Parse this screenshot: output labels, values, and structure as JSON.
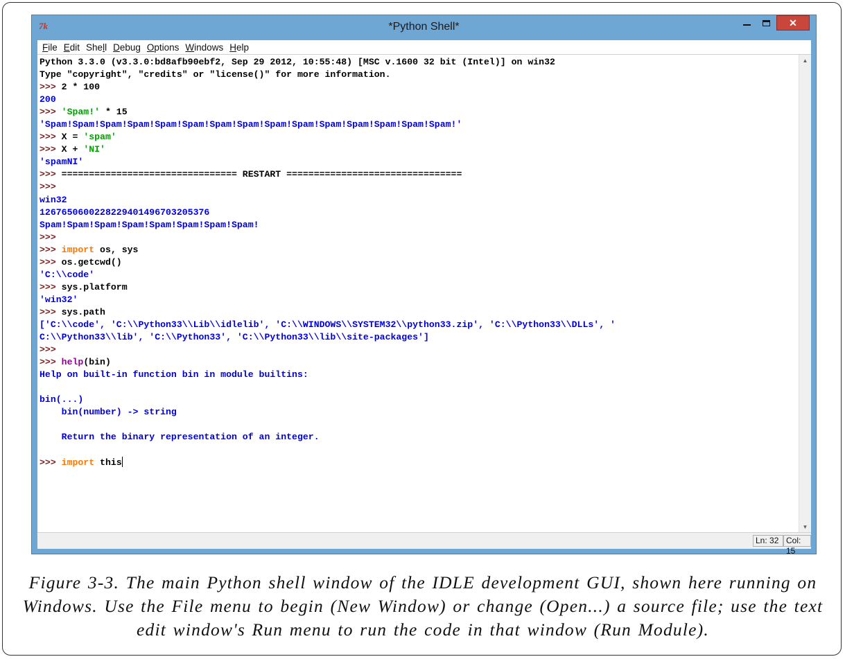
{
  "window": {
    "title": "*Python Shell*",
    "app_icon": "7k",
    "close_label": "✕"
  },
  "menu": [
    {
      "label": "File",
      "u": "F",
      "rest": "ile"
    },
    {
      "label": "Edit",
      "u": "E",
      "rest": "dit"
    },
    {
      "label": "Shell",
      "pre": "She",
      "u": "l",
      "rest": "l"
    },
    {
      "label": "Debug",
      "u": "D",
      "rest": "ebug"
    },
    {
      "label": "Options",
      "u": "O",
      "rest": "ptions"
    },
    {
      "label": "Windows",
      "u": "W",
      "rest": "indows"
    },
    {
      "label": "Help",
      "u": "H",
      "rest": "elp"
    }
  ],
  "shell_lines": [
    [
      [
        "black",
        "Python 3.3.0 (v3.3.0:bd8afb90ebf2, Sep 29 2012, 10:55:48) [MSC v.1600 32 bit (Intel)] on win32"
      ]
    ],
    [
      [
        "black",
        "Type \"copyright\", \"credits\" or \"license()\" for more information."
      ]
    ],
    [
      [
        "maroon",
        ">>> "
      ],
      [
        "black",
        "2 * 100"
      ]
    ],
    [
      [
        "blue",
        "200"
      ]
    ],
    [
      [
        "maroon",
        ">>> "
      ],
      [
        "green",
        "'Spam!'"
      ],
      [
        "black",
        " * 15"
      ]
    ],
    [
      [
        "blue",
        "'Spam!Spam!Spam!Spam!Spam!Spam!Spam!Spam!Spam!Spam!Spam!Spam!Spam!Spam!Spam!'"
      ]
    ],
    [
      [
        "maroon",
        ">>> "
      ],
      [
        "black",
        "X = "
      ],
      [
        "green",
        "'spam'"
      ]
    ],
    [
      [
        "maroon",
        ">>> "
      ],
      [
        "black",
        "X + "
      ],
      [
        "green",
        "'NI'"
      ]
    ],
    [
      [
        "blue",
        "'spamNI'"
      ]
    ],
    [
      [
        "maroon",
        ">>> "
      ],
      [
        "black",
        "================================ RESTART ================================"
      ]
    ],
    [
      [
        "maroon",
        ">>> "
      ]
    ],
    [
      [
        "blue",
        "win32"
      ]
    ],
    [
      [
        "blue",
        "1267650600228229401496703205376"
      ]
    ],
    [
      [
        "blue",
        "Spam!Spam!Spam!Spam!Spam!Spam!Spam!Spam!"
      ]
    ],
    [
      [
        "maroon",
        ">>> "
      ]
    ],
    [
      [
        "maroon",
        ">>> "
      ],
      [
        "orange",
        "import"
      ],
      [
        "black",
        " os, sys"
      ]
    ],
    [
      [
        "maroon",
        ">>> "
      ],
      [
        "black",
        "os.getcwd()"
      ]
    ],
    [
      [
        "blue",
        "'C:\\\\code'"
      ]
    ],
    [
      [
        "maroon",
        ">>> "
      ],
      [
        "black",
        "sys.platform"
      ]
    ],
    [
      [
        "blue",
        "'win32'"
      ]
    ],
    [
      [
        "maroon",
        ">>> "
      ],
      [
        "black",
        "sys.path"
      ]
    ],
    [
      [
        "blue",
        "['C:\\\\code', 'C:\\\\Python33\\\\Lib\\\\idlelib', 'C:\\\\WINDOWS\\\\SYSTEM32\\\\python33.zip', 'C:\\\\Python33\\\\DLLs', '"
      ]
    ],
    [
      [
        "blue",
        "C:\\\\Python33\\\\lib', 'C:\\\\Python33', 'C:\\\\Python33\\\\lib\\\\site-packages']"
      ]
    ],
    [
      [
        "maroon",
        ">>> "
      ]
    ],
    [
      [
        "maroon",
        ">>> "
      ],
      [
        "purple",
        "help"
      ],
      [
        "black",
        "(bin)"
      ]
    ],
    [
      [
        "blue",
        "Help on built-in function bin in module builtins:"
      ]
    ],
    [
      [
        "blue",
        ""
      ]
    ],
    [
      [
        "blue",
        "bin(...)"
      ]
    ],
    [
      [
        "blue",
        "    bin(number) -> string"
      ]
    ],
    [
      [
        "blue",
        ""
      ]
    ],
    [
      [
        "blue",
        "    Return the binary representation of an integer."
      ]
    ],
    [
      [
        "blue",
        ""
      ]
    ],
    [
      [
        "maroon",
        ">>> "
      ],
      [
        "orange",
        "import"
      ],
      [
        "black",
        " this"
      ]
    ]
  ],
  "status": {
    "line": "Ln: 32",
    "col": "Col: 15"
  },
  "caption": "Figure 3-3. The main Python shell window of the IDLE development GUI, shown here running on Windows. Use the File menu to begin (New Window) or change (Open...) a source file; use the text edit window's Run menu to run the code in that window (Run Module)."
}
